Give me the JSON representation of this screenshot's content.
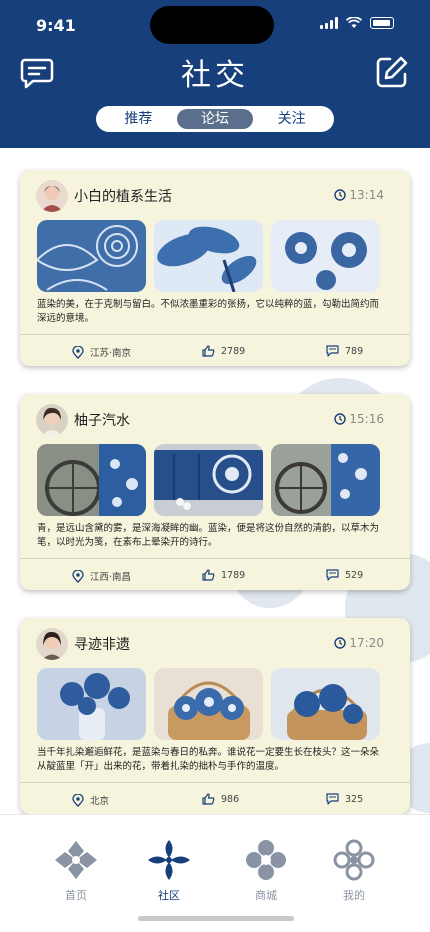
{
  "status_bar": {
    "time": "9:41"
  },
  "header": {
    "title": "社交",
    "tabs": [
      {
        "label": "推荐",
        "active": false
      },
      {
        "label": "论坛",
        "active": true
      },
      {
        "label": "关注",
        "active": false
      }
    ]
  },
  "posts": [
    {
      "author": "小白的植系生活",
      "time": "13:14",
      "text": "蓝染的美，在于克制与留白。不似浓墨重彩的张扬，它以纯粹的蓝，勾勒出简约而深远的意境。",
      "location": "江苏·南京",
      "likes": "2789",
      "comments": "789"
    },
    {
      "author": "柚子汽水",
      "time": "15:16",
      "text": "青，是远山含黛的雾，是深海凝眸的幽。蓝染，便是将这份自然的清韵，以草木为笔，以时光为笺，在素布上晕染开的诗行。",
      "location": "江西·南昌",
      "likes": "1789",
      "comments": "529"
    },
    {
      "author": "寻迹非遗",
      "time": "17:20",
      "text": "当千年扎染邂逅鲜花，是蓝染与春日的私奔。谁说花一定要生长在枝头？这一朵朵从靛蓝里「开」出来的花，带着扎染的拙朴与手作的温度。",
      "location": "北京",
      "likes": "986",
      "comments": "325"
    }
  ],
  "tabbar": [
    {
      "label": "首页",
      "active": false
    },
    {
      "label": "社区",
      "active": true
    },
    {
      "label": "商城",
      "active": false
    },
    {
      "label": "我的",
      "active": false
    }
  ],
  "colors": {
    "header_bg": "#163f7c",
    "card_bg": "#f6f4dd",
    "active_tab": "#163f7c",
    "inactive_tab": "#8a93a3"
  }
}
